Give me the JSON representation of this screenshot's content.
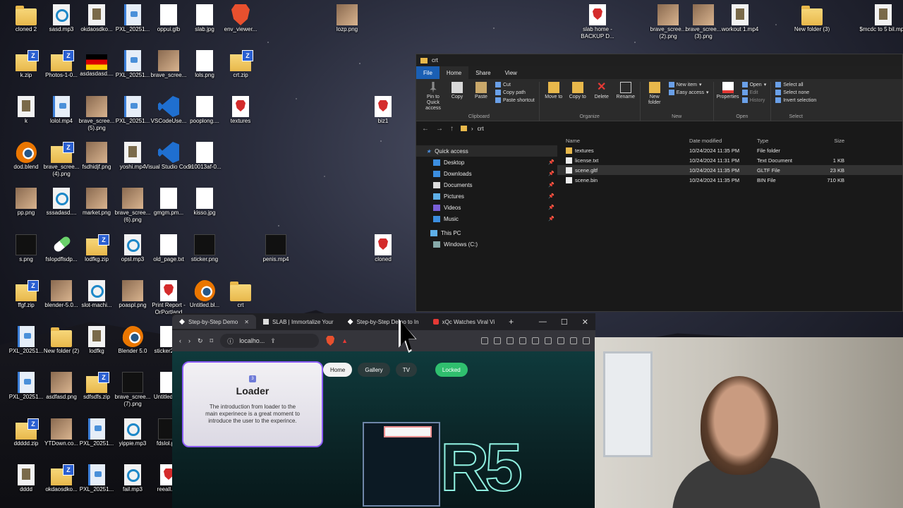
{
  "desktop_icons": [
    {
      "label": "cloned 2",
      "type": "folder"
    },
    {
      "label": "sasd.mp3",
      "type": "audio"
    },
    {
      "label": "okdaosdko...",
      "type": "video"
    },
    {
      "label": "PXL_20251...",
      "type": "img"
    },
    {
      "label": "oppui.glb",
      "type": "white"
    },
    {
      "label": "slab.jpg",
      "type": "white"
    },
    {
      "label": "env_viewer...",
      "type": "brave"
    },
    {
      "label": "lozp.png",
      "type": "photo"
    },
    {
      "label": "slab home - BACKUP D...",
      "type": "pdf"
    },
    {
      "label": "brave_scree... (2).png",
      "type": "photo"
    },
    {
      "label": "brave_scree... (3).png",
      "type": "photo"
    },
    {
      "label": "workout 1.mp4",
      "type": "video"
    },
    {
      "label": "New folder (3)",
      "type": "folder"
    },
    {
      "label": "$mcdc to 5 bil.mp4",
      "type": "video"
    },
    {
      "label": "k.zip",
      "type": "zip"
    },
    {
      "label": "Photos-1-0...",
      "type": "zip"
    },
    {
      "label": "asdasdasd....",
      "type": "flag"
    },
    {
      "label": "PXL_20251...",
      "type": "img"
    },
    {
      "label": "brave_scree...",
      "type": "photo"
    },
    {
      "label": "lols.png",
      "type": "white"
    },
    {
      "label": "crt.zip",
      "type": "zip"
    },
    {
      "label": "k",
      "type": "video"
    },
    {
      "label": "lolol.mp4",
      "type": "img"
    },
    {
      "label": "brave_scree... (5).png",
      "type": "photo"
    },
    {
      "label": "PXL_20251...",
      "type": "img"
    },
    {
      "label": "VSCodeUse...",
      "type": "vscode"
    },
    {
      "label": "pooplong....",
      "type": "white"
    },
    {
      "label": "textures",
      "type": "pdf"
    },
    {
      "label": "biz1",
      "type": "pdf"
    },
    {
      "label": "dod.blend",
      "type": "blend"
    },
    {
      "label": "brave_scree... (4).png",
      "type": "zip"
    },
    {
      "label": "fsdhidjf.png",
      "type": "photo"
    },
    {
      "label": "yoshi.mp4",
      "type": "video"
    },
    {
      "label": "Visual Studio Code",
      "type": "vscode"
    },
    {
      "label": "910013af-0...",
      "type": "white"
    },
    {
      "label": "pp.png",
      "type": "photo"
    },
    {
      "label": "sssadasd....",
      "type": "audio"
    },
    {
      "label": "market.png",
      "type": "photo"
    },
    {
      "label": "brave_scree... (6).png",
      "type": "photo"
    },
    {
      "label": "gmgm.pm...",
      "type": "white"
    },
    {
      "label": "kisso.jpg",
      "type": "white"
    },
    {
      "label": "s.png",
      "type": "black"
    },
    {
      "label": "fslopdflsdp...",
      "type": "pill"
    },
    {
      "label": "lodfkg.zip",
      "type": "zip"
    },
    {
      "label": "opsl.mp3",
      "type": "audio"
    },
    {
      "label": "old_page.txt",
      "type": "white"
    },
    {
      "label": "sticker.png",
      "type": "black"
    },
    {
      "label": "penis.mp4",
      "type": "black"
    },
    {
      "label": "cloned",
      "type": "pdf"
    },
    {
      "label": "ffgf.zip",
      "type": "zip"
    },
    {
      "label": "blender-5.0...",
      "type": "photo"
    },
    {
      "label": "slot-machi...",
      "type": "audio"
    },
    {
      "label": "poaspl.png",
      "type": "photo"
    },
    {
      "label": "Print Report - OrPortland",
      "type": "pdf"
    },
    {
      "label": "Untitled.bl...",
      "type": "blend"
    },
    {
      "label": "crt",
      "type": "folder"
    },
    {
      "label": "PXL_20251...",
      "type": "img"
    },
    {
      "label": "New folder (2)",
      "type": "folder"
    },
    {
      "label": "lodfkg",
      "type": "video"
    },
    {
      "label": "Blender 5.0",
      "type": "blend"
    },
    {
      "label": "sticker2.p...",
      "type": "white"
    },
    {
      "label": "PXL_20251...",
      "type": "img"
    },
    {
      "label": "asdfasd.png",
      "type": "photo"
    },
    {
      "label": "sdfsdfs.zip",
      "type": "zip"
    },
    {
      "label": "brave_scree... (7).png",
      "type": "black"
    },
    {
      "label": "Untitled.bl...",
      "type": "white"
    },
    {
      "label": "ddddd.zip",
      "type": "zip"
    },
    {
      "label": "YTDown.co...",
      "type": "photo"
    },
    {
      "label": "PXL_20251...",
      "type": "img"
    },
    {
      "label": "yippie.mp3",
      "type": "audio"
    },
    {
      "label": "fdslol.png",
      "type": "black"
    },
    {
      "label": "dddd",
      "type": "video"
    },
    {
      "label": "okdaosdko...",
      "type": "zip"
    },
    {
      "label": "PXL_20251...",
      "type": "img"
    },
    {
      "label": "fail.mp3",
      "type": "audio"
    },
    {
      "label": "reeall.pdf",
      "type": "pdf"
    }
  ],
  "explorer": {
    "title": "crt",
    "tabs": [
      "File",
      "Home",
      "Share",
      "View"
    ],
    "ribbon": {
      "clipboard": {
        "name": "Clipboard",
        "pin": "Pin to Quick access",
        "copy": "Copy",
        "paste": "Paste",
        "cut": "Cut",
        "copy_path": "Copy path",
        "paste_shortcut": "Paste shortcut"
      },
      "organize": {
        "name": "Organize",
        "move_to": "Move to",
        "copy_to": "Copy to",
        "delete": "Delete",
        "rename": "Rename"
      },
      "new": {
        "name": "New",
        "new_folder": "New folder",
        "new_item": "New item",
        "easy_access": "Easy access"
      },
      "open": {
        "name": "Open",
        "properties": "Properties",
        "open": "Open",
        "edit": "Edit",
        "history": "History"
      },
      "select": {
        "name": "Select",
        "select_all": "Select all",
        "select_none": "Select none",
        "invert": "Invert selection"
      }
    },
    "path": "crt",
    "nav": {
      "quick_access": "Quick access",
      "items": [
        "Desktop",
        "Downloads",
        "Documents",
        "Pictures",
        "Videos",
        "Music"
      ],
      "this_pc": "This PC",
      "drive": "Windows (C:)"
    },
    "columns": [
      "Name",
      "Date modified",
      "Type",
      "Size"
    ],
    "files": [
      {
        "name": "textures",
        "date": "10/24/2024 11:35 PM",
        "type": "File folder",
        "size": ""
      },
      {
        "name": "license.txt",
        "date": "10/24/2024 11:31 PM",
        "type": "Text Document",
        "size": "1 KB"
      },
      {
        "name": "scene.gltf",
        "date": "10/24/2024 11:35 PM",
        "type": "GLTF File",
        "size": "23 KB"
      },
      {
        "name": "scene.bin",
        "date": "10/24/2024 11:35 PM",
        "type": "BIN File",
        "size": "710 KB"
      }
    ]
  },
  "browser": {
    "tabs": [
      {
        "label": "Step-by-Step Demo",
        "active": true
      },
      {
        "label": "SLAB | Immortalize Your",
        "active": false
      },
      {
        "label": "Step-by-Step Demo to In",
        "active": false
      },
      {
        "label": "xQc Watches Viral Vi",
        "active": false
      }
    ],
    "url": "localho...",
    "page": {
      "card_number": "3",
      "card_title": "Loader",
      "card_text": "The introduction from loader to the main experinece is a great moment to introduce the user to the experince.",
      "nav": [
        "Home",
        "Gallery",
        "TV"
      ],
      "locked": "Locked",
      "logo_text": "R5"
    }
  }
}
